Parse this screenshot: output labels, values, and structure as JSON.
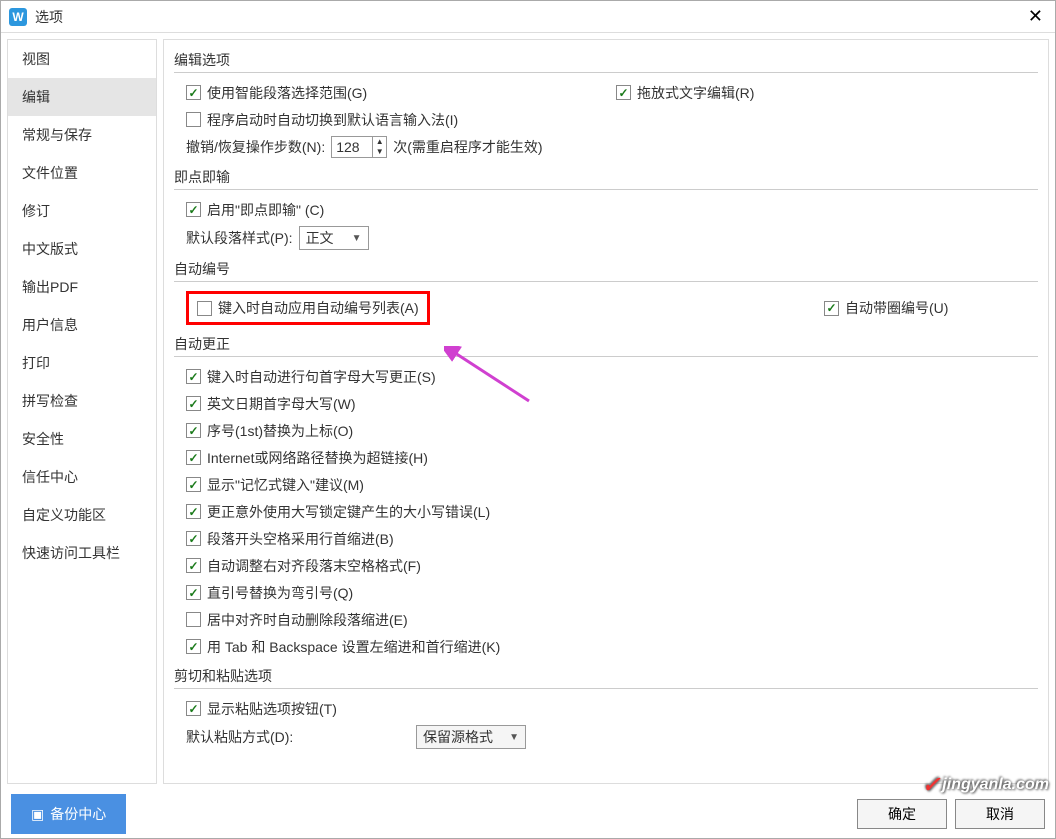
{
  "title": "选项",
  "sidebar": {
    "items": [
      {
        "label": "视图"
      },
      {
        "label": "编辑"
      },
      {
        "label": "常规与保存"
      },
      {
        "label": "文件位置"
      },
      {
        "label": "修订"
      },
      {
        "label": "中文版式"
      },
      {
        "label": "输出PDF"
      },
      {
        "label": "用户信息"
      },
      {
        "label": "打印"
      },
      {
        "label": "拼写检查"
      },
      {
        "label": "安全性"
      },
      {
        "label": "信任中心"
      },
      {
        "label": "自定义功能区"
      },
      {
        "label": "快速访问工具栏"
      }
    ],
    "active_index": 1
  },
  "sections": {
    "edit_options": {
      "title": "编辑选项",
      "smart_paragraph": "使用智能段落选择范围(G)",
      "drag_drop": "拖放式文字编辑(R)",
      "ime_switch": "程序启动时自动切换到默认语言输入法(I)",
      "undo_label": "撤销/恢复操作步数(N):",
      "undo_value": "128",
      "undo_suffix": "次(需重启程序才能生效)"
    },
    "click_type": {
      "title": "即点即输",
      "enable": "启用\"即点即输\" (C)",
      "style_label": "默认段落样式(P):",
      "style_value": "正文"
    },
    "auto_number": {
      "title": "自动编号",
      "auto_list": "键入时自动应用自动编号列表(A)",
      "auto_circle": "自动带圈编号(U)"
    },
    "auto_correct": {
      "title": "自动更正",
      "items": [
        "键入时自动进行句首字母大写更正(S)",
        "英文日期首字母大写(W)",
        "序号(1st)替换为上标(O)",
        "Internet或网络路径替换为超链接(H)",
        "显示\"记忆式键入\"建议(M)",
        "更正意外使用大写锁定键产生的大小写错误(L)",
        "段落开头空格采用行首缩进(B)",
        "自动调整右对齐段落末空格格式(F)",
        "直引号替换为弯引号(Q)",
        "居中对齐时自动删除段落缩进(E)",
        "用 Tab 和 Backspace 设置左缩进和首行缩进(K)"
      ],
      "checked": [
        true,
        true,
        true,
        true,
        true,
        true,
        true,
        true,
        true,
        false,
        true
      ]
    },
    "paste": {
      "title": "剪切和粘贴选项",
      "show_btn": "显示粘贴选项按钮(T)",
      "default_label": "默认粘贴方式(D):",
      "default_value": "保留源格式"
    }
  },
  "footer": {
    "backup": "备份中心",
    "ok": "确定",
    "cancel": "取消"
  },
  "watermark": "jingyanla.com"
}
